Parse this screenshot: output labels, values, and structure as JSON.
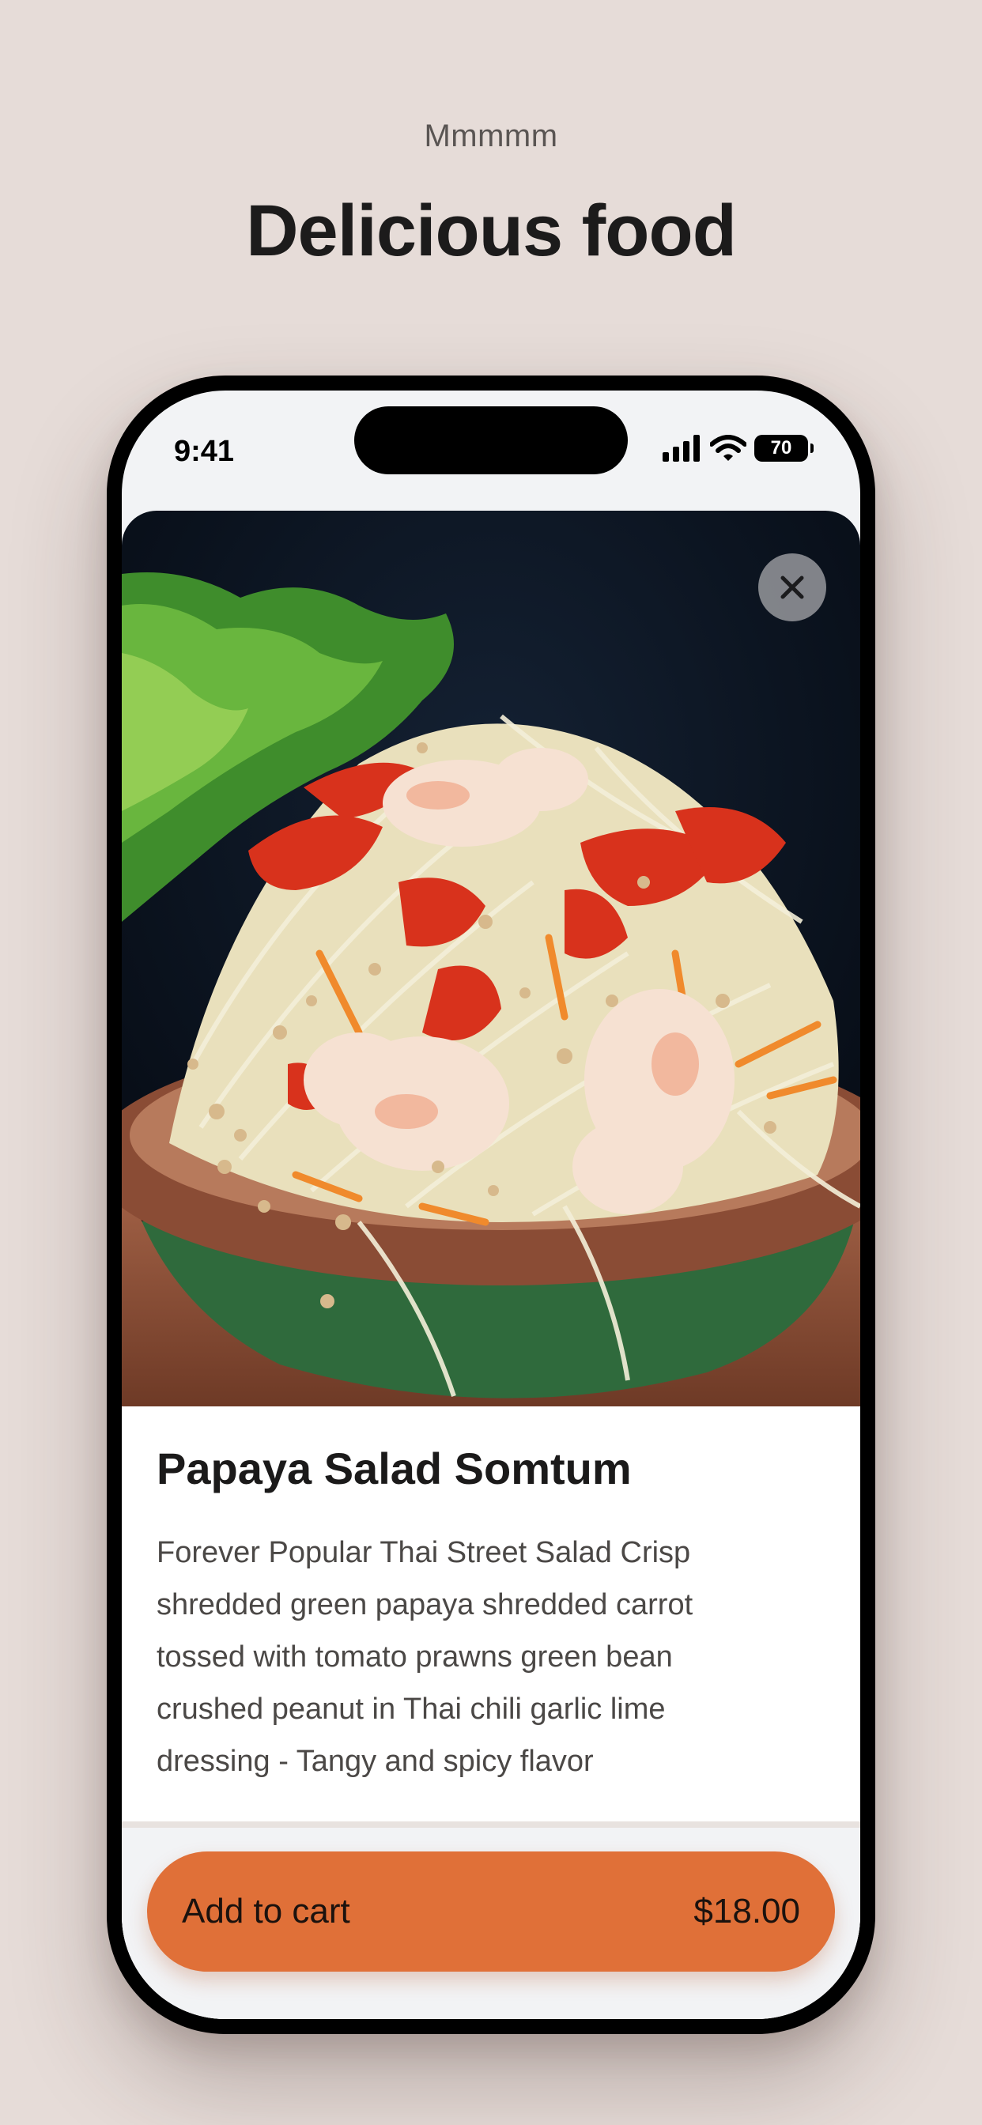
{
  "header": {
    "eyebrow": "Mmmmm",
    "title": "Delicious food"
  },
  "status_bar": {
    "time": "9:41",
    "battery": "70",
    "icons": [
      "cellular-signal-icon",
      "wifi-icon",
      "battery-icon"
    ]
  },
  "item": {
    "image_icon": "food-photo",
    "title": "Papaya Salad Somtum",
    "description": "Forever Popular Thai Street Salad Crisp shredded green papaya shredded carrot tossed with tomato prawns green bean crushed peanut in Thai chili garlic lime dressing - Tangy and spicy flavor"
  },
  "actions": {
    "close_icon": "close-icon",
    "add_to_cart_label": "Add to cart",
    "price": "$18.00"
  },
  "colors": {
    "background": "#e6dcd8",
    "accent": "#e07038",
    "text_primary": "#1b1a1a",
    "text_secondary": "#4b4846"
  }
}
